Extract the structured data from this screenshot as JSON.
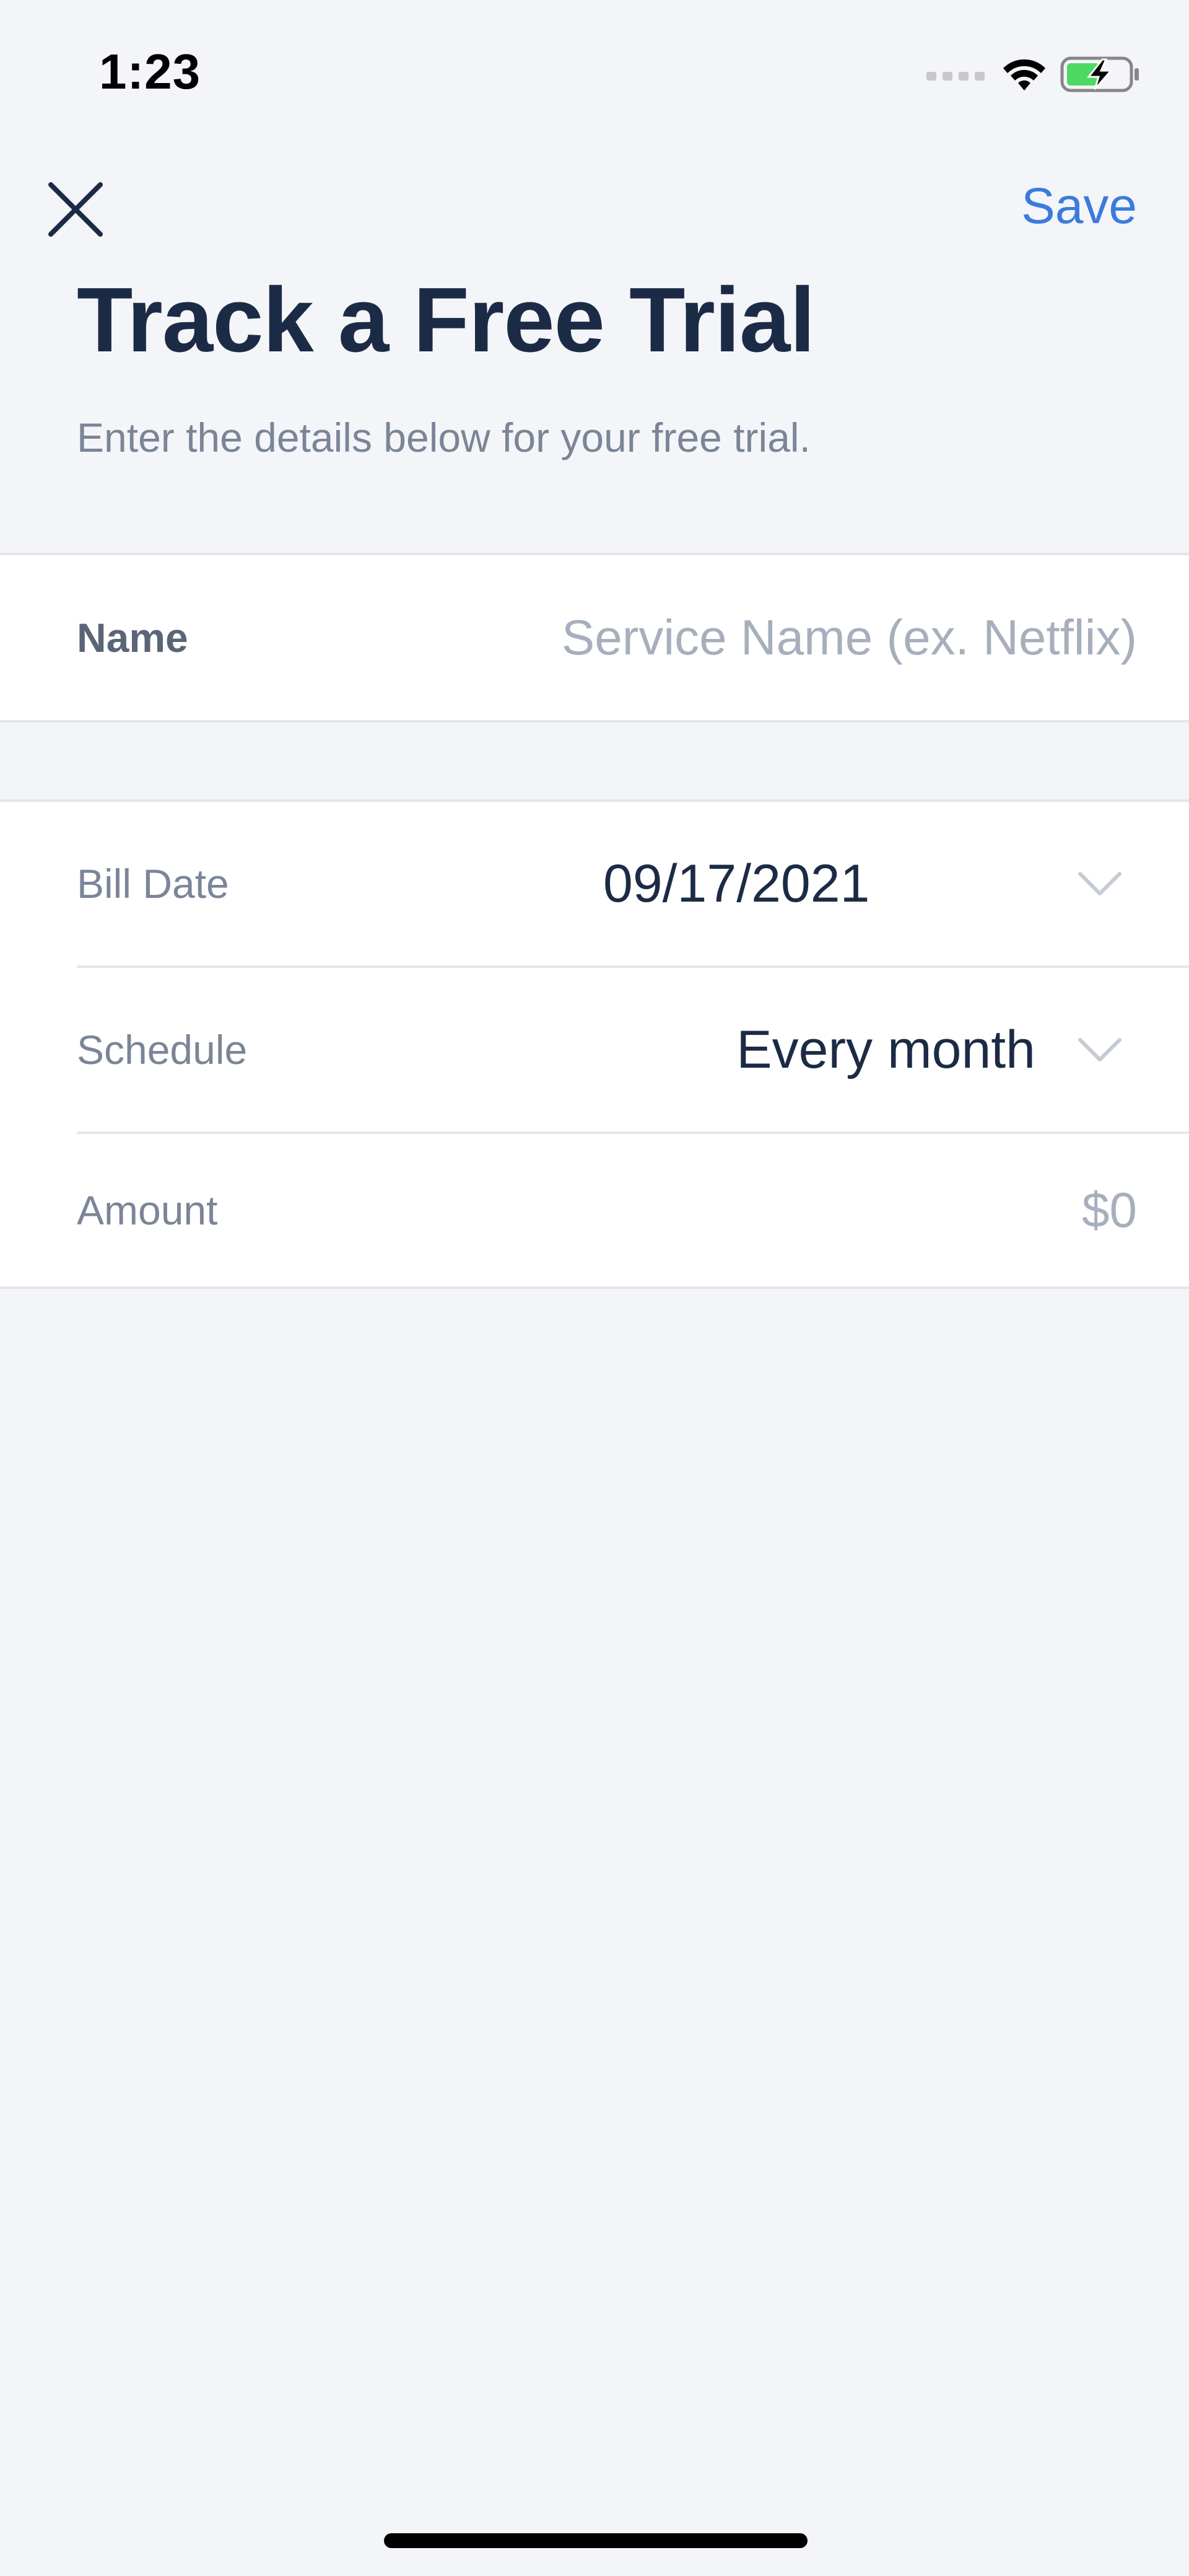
{
  "status_bar": {
    "time": "1:23",
    "icons": [
      "cellular-signal-icon",
      "wifi-icon",
      "battery-charging-icon"
    ]
  },
  "nav": {
    "close_icon": "close-icon",
    "save_label": "Save"
  },
  "header": {
    "title": "Track a Free Trial",
    "subtitle": "Enter the details below for your free trial."
  },
  "form": {
    "name": {
      "label": "Name",
      "value": "",
      "placeholder": "Service Name (ex. Netflix)"
    },
    "bill_date": {
      "label": "Bill Date",
      "value": "09/17/2021",
      "icon": "chevron-down-icon"
    },
    "schedule": {
      "label": "Schedule",
      "value": "Every month",
      "icon": "chevron-down-icon"
    },
    "amount": {
      "label": "Amount",
      "placeholder": "$0"
    }
  },
  "colors": {
    "accent": "#3b7bdd",
    "background": "#f4f5f8",
    "text_primary": "#1c2b45",
    "text_secondary": "#7b8597",
    "placeholder": "#a7afbd",
    "battery_fill": "#4cd964"
  }
}
